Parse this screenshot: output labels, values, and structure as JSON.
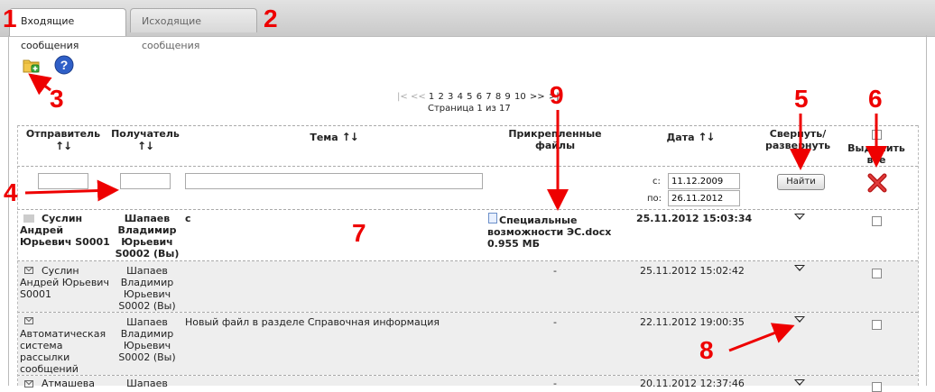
{
  "tabs": {
    "inbox": "Входящие сообщения",
    "outbox": "Исходящие сообщения"
  },
  "toolbar": {
    "new_icon": "folder-add-icon",
    "help_icon": "help-icon"
  },
  "pager": {
    "first": "|<",
    "prev": "<<",
    "pages": [
      "1",
      "2",
      "3",
      "4",
      "5",
      "6",
      "7",
      "8",
      "9",
      "10"
    ],
    "next": ">>",
    "last": ">|",
    "info": "Страница 1 из 17"
  },
  "columns": {
    "sender": "Отправитель",
    "recipient": "Получатель",
    "subject": "Тема",
    "files": "Прикрепленные файлы",
    "date": "Дата",
    "toggle": "Свернуть/ развернуть",
    "select_all": "Выделить все",
    "sort_arrows": "↑↓"
  },
  "filter": {
    "from_label": "с:",
    "to_label": "по:",
    "date_from": "11.12.2009",
    "date_to": "26.11.2012",
    "find_button": "Найти"
  },
  "rows": [
    {
      "sender": "Суслин Андрей Юрьевич S0001",
      "recipient": "Шапаев Владимир Юрьевич S0002 (Вы)",
      "subject": "с",
      "file_name": "Специальные возможности ЭС.docx",
      "file_size": "0.955 МБ",
      "date": "25.11.2012 15:03:34",
      "unread": true
    },
    {
      "sender": "Суслин Андрей Юрьевич S0001",
      "recipient": "Шапаев Владимир Юрьевич S0002 (Вы)",
      "subject": "",
      "files": "-",
      "date": "25.11.2012 15:02:42",
      "unread": false
    },
    {
      "sender": "Автоматическая система рассылки сообщений",
      "recipient": "Шапаев Владимир Юрьевич S0002 (Вы)",
      "subject": "Новый файл в разделе Справочная информация",
      "files": "-",
      "date": "22.11.2012 19:00:35",
      "unread": false
    },
    {
      "sender": "Атмашева",
      "recipient": "Шапаев",
      "files": "-",
      "date": "20.11.2012 12:37:46",
      "unread": false
    }
  ],
  "annotations": [
    "1",
    "2",
    "3",
    "4",
    "5",
    "6",
    "7",
    "8",
    "9"
  ],
  "colors": {
    "annotation": "#e00000",
    "row_alt": "#eeeeee",
    "tabbar": "#d6d6d6"
  }
}
